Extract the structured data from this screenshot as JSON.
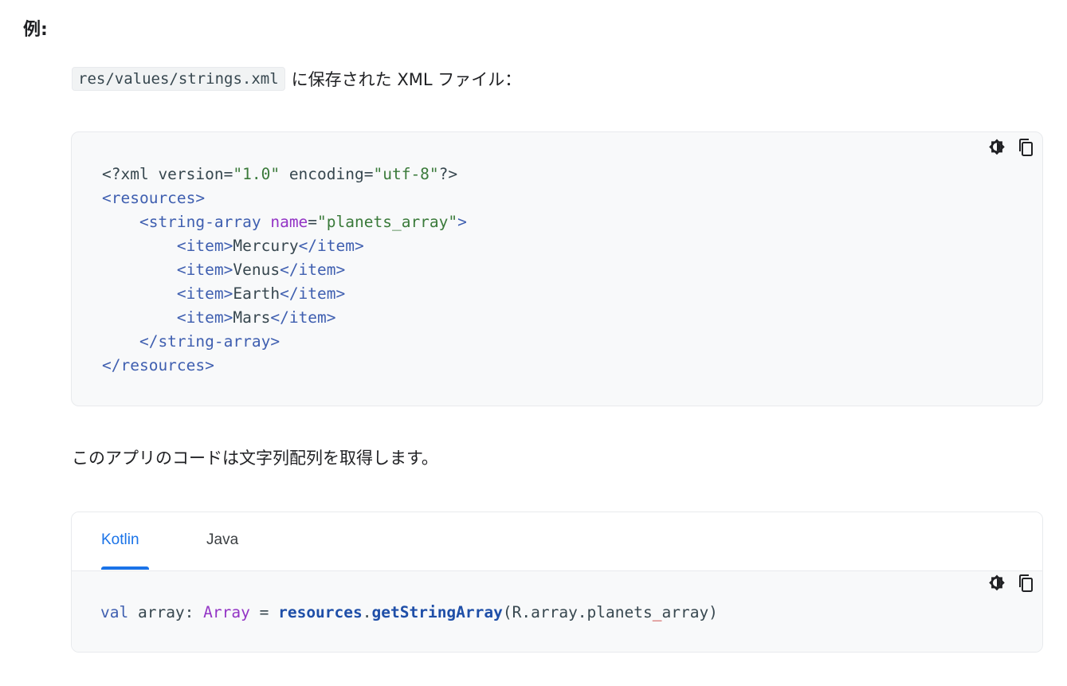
{
  "example_heading": "例:",
  "intro": {
    "file_path": "res/values/strings.xml",
    "text": "に保存された XML ファイル："
  },
  "xml_block": {
    "theme_toggle_icon": "brightness-contrast-icon",
    "copy_icon": "copy-icon",
    "lines": {
      "l1_a": "<?xml version=",
      "l1_b": "\"1.0\"",
      "l1_c": " encoding=",
      "l1_d": "\"utf-8\"",
      "l1_e": "?>",
      "l2": "<resources>",
      "l3_a": "    <string-array",
      "l3_b": " name",
      "l3_c": "=",
      "l3_d": "\"planets_array\"",
      "l3_e": ">",
      "item_open": "<item>",
      "item_close": "</item>",
      "items": [
        "Mercury",
        "Venus",
        "Earth",
        "Mars"
      ],
      "l8": "    </string-array>",
      "l9": "</resources>"
    }
  },
  "paragraph": "このアプリのコードは文字列配列を取得します。",
  "code_tabs": {
    "tabs": [
      "Kotlin",
      "Java"
    ],
    "active_tab": "Kotlin",
    "kotlin": {
      "kw_val": "val",
      "name": " array: ",
      "type": "Array",
      "eq": " = ",
      "fn1": "resources",
      "dot": ".",
      "fn2": "getStringArray",
      "args_a": "(R.array.planets",
      "args_under": "_",
      "args_b": "array)"
    }
  },
  "colors": {
    "accent": "#1a73e8",
    "code_bg": "#f8f9fa",
    "tag": "#3f5fb0",
    "attr": "#9334c5",
    "string": "#3a7a3a"
  }
}
